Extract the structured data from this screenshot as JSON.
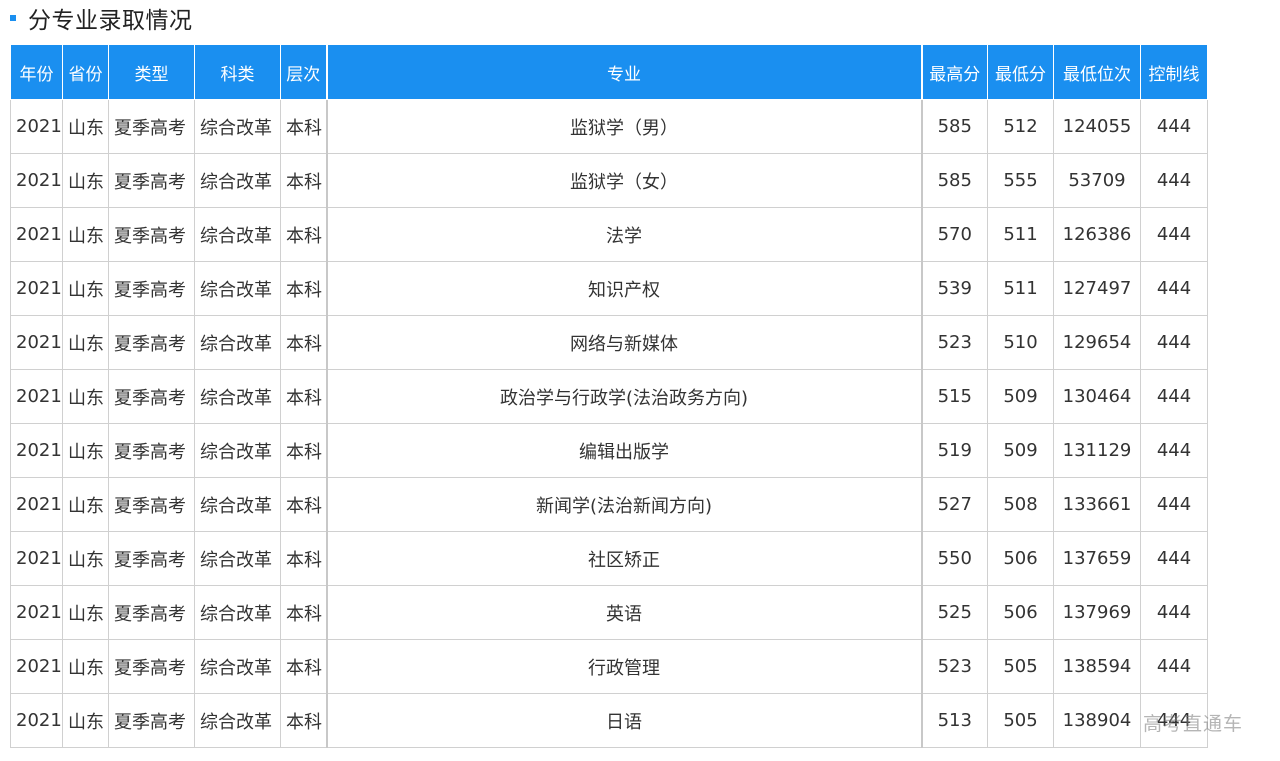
{
  "section": {
    "title": "分专业录取情况",
    "accent_color": "#1a8ff0"
  },
  "table": {
    "headers": [
      "年份",
      "省份",
      "类型",
      "科类",
      "层次",
      "专业",
      "最高分",
      "最低分",
      "最低位次",
      "控制线"
    ],
    "header_bg": "#1a8ff0",
    "rows": [
      [
        "2021",
        "山东",
        "夏季高考",
        "综合改革",
        "本科",
        "监狱学（男）",
        "585",
        "512",
        "124055",
        "444"
      ],
      [
        "2021",
        "山东",
        "夏季高考",
        "综合改革",
        "本科",
        "监狱学（女）",
        "585",
        "555",
        "53709",
        "444"
      ],
      [
        "2021",
        "山东",
        "夏季高考",
        "综合改革",
        "本科",
        "法学",
        "570",
        "511",
        "126386",
        "444"
      ],
      [
        "2021",
        "山东",
        "夏季高考",
        "综合改革",
        "本科",
        "知识产权",
        "539",
        "511",
        "127497",
        "444"
      ],
      [
        "2021",
        "山东",
        "夏季高考",
        "综合改革",
        "本科",
        "网络与新媒体",
        "523",
        "510",
        "129654",
        "444"
      ],
      [
        "2021",
        "山东",
        "夏季高考",
        "综合改革",
        "本科",
        "政治学与行政学(法治政务方向)",
        "515",
        "509",
        "130464",
        "444"
      ],
      [
        "2021",
        "山东",
        "夏季高考",
        "综合改革",
        "本科",
        "编辑出版学",
        "519",
        "509",
        "131129",
        "444"
      ],
      [
        "2021",
        "山东",
        "夏季高考",
        "综合改革",
        "本科",
        "新闻学(法治新闻方向)",
        "527",
        "508",
        "133661",
        "444"
      ],
      [
        "2021",
        "山东",
        "夏季高考",
        "综合改革",
        "本科",
        "社区矫正",
        "550",
        "506",
        "137659",
        "444"
      ],
      [
        "2021",
        "山东",
        "夏季高考",
        "综合改革",
        "本科",
        "英语",
        "525",
        "506",
        "137969",
        "444"
      ],
      [
        "2021",
        "山东",
        "夏季高考",
        "综合改革",
        "本科",
        "行政管理",
        "523",
        "505",
        "138594",
        "444"
      ],
      [
        "2021",
        "山东",
        "夏季高考",
        "综合改革",
        "本科",
        "日语",
        "513",
        "505",
        "138904",
        "444"
      ]
    ]
  },
  "watermark": {
    "text": "高考直通车"
  }
}
